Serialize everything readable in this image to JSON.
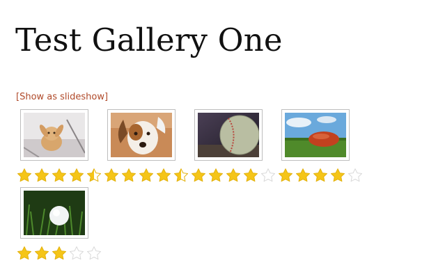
{
  "page": {
    "title": "Test Gallery One",
    "slideshow_link": "[Show as slideshow]"
  },
  "gallery": {
    "items": [
      {
        "subject": "bunny",
        "rating": 4.5,
        "max_rating": 5
      },
      {
        "subject": "puppy",
        "rating": 4.5,
        "max_rating": 5
      },
      {
        "subject": "baseball",
        "rating": 4,
        "max_rating": 5
      },
      {
        "subject": "football",
        "rating": 4,
        "max_rating": 5
      },
      {
        "subject": "golf-ball",
        "rating": 3,
        "max_rating": 5
      }
    ]
  },
  "colors": {
    "star_fill": "#f5c518",
    "star_empty": "#ffffff",
    "star_outline": "#d9d9d9",
    "link": "#b04a2a"
  }
}
